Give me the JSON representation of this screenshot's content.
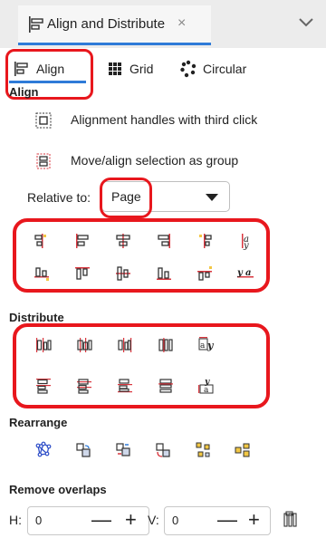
{
  "dock": {
    "tab_title": "Align and Distribute",
    "close_symbol": "×"
  },
  "subtabs": {
    "align": "Align",
    "grid": "Grid",
    "circular": "Circular"
  },
  "align_section": {
    "heading": "Align",
    "handles_label": "Alignment handles with third click",
    "group_label": "Move/align selection as group",
    "relative_label": "Relative to:",
    "relative_value": "Page"
  },
  "distribute_section": {
    "heading": "Distribute"
  },
  "rearrange_section": {
    "heading": "Rearrange"
  },
  "overlap_section": {
    "heading": "Remove overlaps",
    "h_label": "H:",
    "h_value": "0",
    "v_label": "V:",
    "v_value": "0",
    "minus": "—",
    "plus": "+"
  },
  "icons": {
    "align_row1": [
      "align-right-edge-to-left-icon",
      "align-left-edges-icon",
      "center-vertical-axis-icon",
      "align-right-edges-icon",
      "align-left-edge-to-right-icon",
      "align-baselines-anchor-icon"
    ],
    "align_row2": [
      "align-bottom-to-top-icon",
      "align-top-edges-icon",
      "center-horizontal-axis-icon",
      "align-bottom-edges-icon",
      "align-top-to-bottom-icon",
      "align-baseline-text-icon"
    ],
    "distribute_row1": [
      "distribute-left-edges-icon",
      "distribute-centers-h-icon",
      "distribute-right-edges-icon",
      "distribute-gaps-h-icon",
      "distribute-text-h-icon"
    ],
    "distribute_row2": [
      "distribute-top-edges-icon",
      "distribute-centers-v-icon",
      "distribute-bottom-edges-icon",
      "distribute-gaps-v-icon",
      "distribute-text-v-icon"
    ],
    "rearrange_row": [
      "graph-layout-icon",
      "exchange-selection-order-icon",
      "exchange-z-order-icon",
      "exchange-clockwise-icon",
      "randomize-positions-icon",
      "unclump-icon"
    ]
  },
  "colors": {
    "accent": "#2f7bd8",
    "highlight": "#e8171d",
    "icon_red": "#d9363e",
    "icon_yellow": "#f2c744"
  }
}
